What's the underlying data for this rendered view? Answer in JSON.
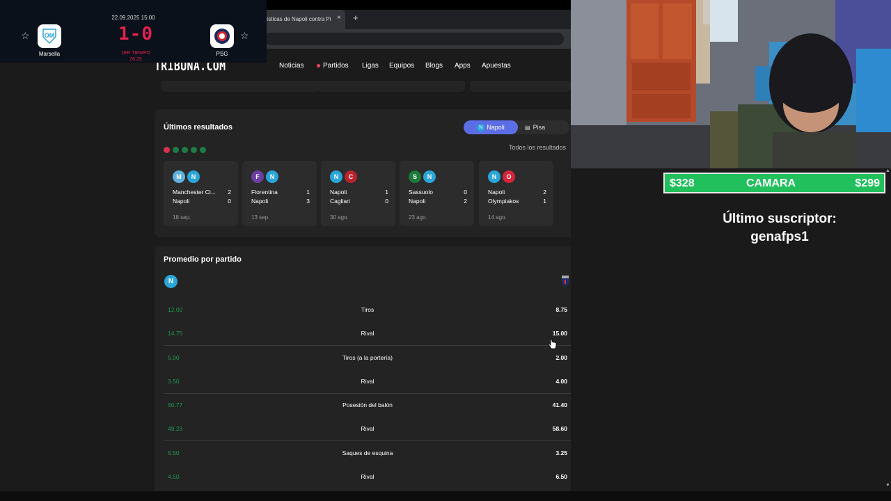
{
  "browser": {
    "tab_title": "ísticas de Napoli contra Pi",
    "tab_close": "×",
    "new_tab": "+"
  },
  "site": {
    "logo": "TRIBUNA.COM",
    "nav": [
      "Noticias",
      "Partidos",
      "Ligas",
      "Equipos",
      "Blogs",
      "Apps",
      "Apuestas"
    ]
  },
  "scoreboard": {
    "datetime": "22.09.2025 15:00",
    "score": "1-0",
    "period": "1ER TIEMPO",
    "minute": "26:25",
    "home": "Marsella",
    "away": "PSG"
  },
  "results": {
    "title": "Últimos resultados",
    "toggle_home": "Napoli",
    "toggle_away": "Pisa",
    "all_results": "Todos los resultados",
    "form": [
      "loss",
      "win",
      "win",
      "win",
      "win"
    ],
    "form_colors": {
      "loss": "#d9324f",
      "win": "#1f7a45"
    },
    "matches": [
      {
        "team1": "Manchester Ci...",
        "score1": "2",
        "team2": "Napoli",
        "score2": "0",
        "date": "18 sep."
      },
      {
        "team1": "Florentina",
        "score1": "1",
        "team2": "Napoli",
        "score2": "3",
        "date": "13 sep."
      },
      {
        "team1": "Napoli",
        "score1": "1",
        "team2": "Cagliari",
        "score2": "0",
        "date": "30 ago."
      },
      {
        "team1": "Sassuolo",
        "score1": "0",
        "team2": "Napoli",
        "score2": "2",
        "date": "23 ago."
      },
      {
        "team1": "Napoli",
        "score1": "2",
        "team2": "Olympiakos",
        "score2": "1",
        "date": "14 ago."
      }
    ]
  },
  "averages": {
    "title": "Promedio por partido",
    "home_badge": "N",
    "rows": [
      {
        "left": "12.00",
        "label": "Tiros",
        "right": "8.75"
      },
      {
        "left": "14.75",
        "label": "Rival",
        "right": "15.00"
      },
      {
        "left": "5.00",
        "label": "Tiros (a la portería)",
        "right": "2.00"
      },
      {
        "left": "3.50",
        "label": "Rival",
        "right": "4.00"
      },
      {
        "left": "50.77",
        "label": "Posesión del balón",
        "right": "41.40"
      },
      {
        "left": "49.23",
        "label": "Rival",
        "right": "58.60"
      },
      {
        "left": "5.50",
        "label": "Saques de esquina",
        "right": "3.25"
      },
      {
        "left": "4.50",
        "label": "Rival",
        "right": "6.50"
      }
    ]
  },
  "stream": {
    "left_amount": "$328",
    "camara_label": "CAMARA",
    "right_amount": "$299",
    "subscriber_label": "Último suscriptor:",
    "subscriber_name": "genafps1"
  }
}
